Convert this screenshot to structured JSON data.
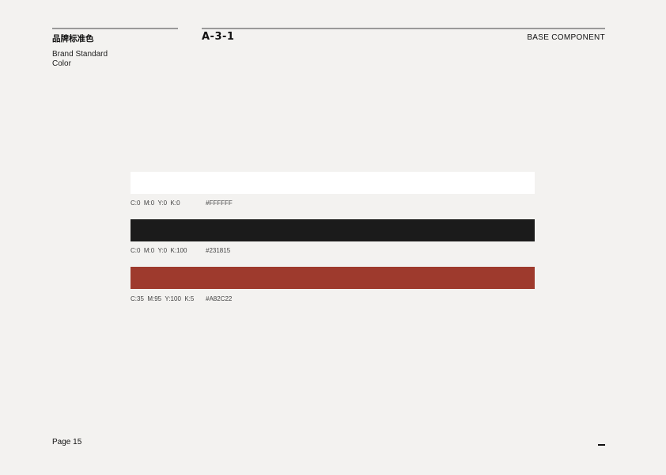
{
  "header": {
    "title_cn": "品牌标准色",
    "subtitle": "Brand Standard Color",
    "code": "A-3-1",
    "section": "BASE COMPONENT"
  },
  "colors": [
    {
      "cmyk": "C:0  M:0  Y:0  K:0",
      "hex": "#FFFFFF",
      "swatch": "#ffffff"
    },
    {
      "cmyk": "C:0  M:0  Y:0  K:100",
      "hex": "#231815",
      "swatch": "#1b1b1b"
    },
    {
      "cmyk": "C:35  M:95  Y:100  K:5",
      "hex": "#A82C22",
      "swatch": "#9e3a2d"
    }
  ],
  "footer": {
    "page": "Page 15"
  }
}
